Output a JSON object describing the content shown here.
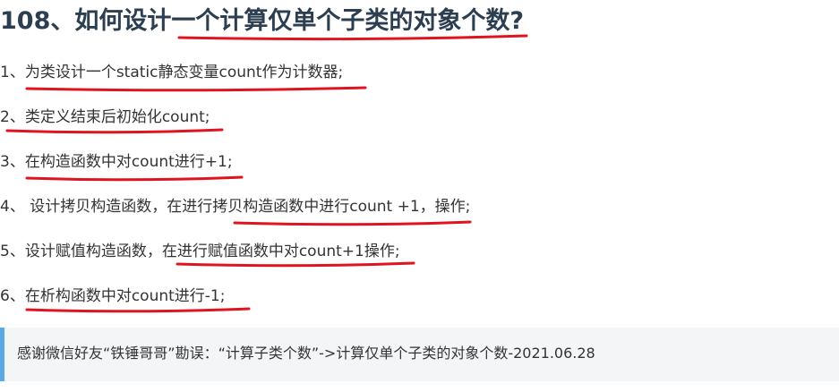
{
  "heading": "108、如何设计一个计算仅单个子类的对象个数?",
  "items": [
    "1、为类设计一个static静态变量count作为计数器;",
    "2、类定义结束后初始化count;",
    "3、在构造函数中对count进行+1;",
    "4、 设计拷贝构造函数，在进行拷贝构造函数中进行count +1，操作;",
    "5、设计赋值构造函数，在进行赋值函数中对count+1操作;",
    "6、在析构函数中对count进行-1;"
  ],
  "tip": "感谢微信好友“铁锤哥哥”勘误：“计算子类个数”->计算仅单个子类的对象个数-2021.06.28",
  "colors": {
    "underline": "#e0141e",
    "tip_border": "#5aa8e6",
    "tip_bg": "#f3f5f7",
    "heading": "#2c3e50"
  }
}
